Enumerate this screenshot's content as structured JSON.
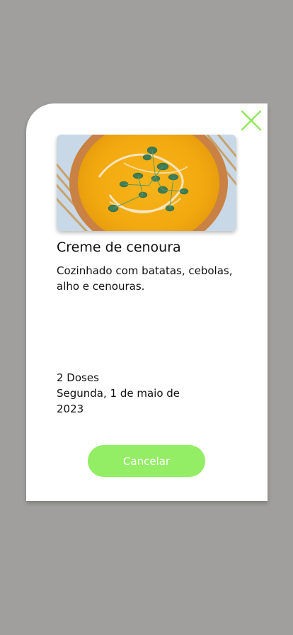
{
  "recipe": {
    "title": "Creme de cenoura",
    "description": "Cozinhado com batatas, cebolas, alho e cenouras.",
    "doses": "2 Doses",
    "date": "Segunda, 1 de maio de 2023"
  },
  "actions": {
    "cancel_label": "Cancelar"
  },
  "icons": {
    "close": "close-icon"
  },
  "colors": {
    "overlay": "#a09f9d",
    "card": "#ffffff",
    "accent": "#94ee65",
    "close_icon": "#8fe85d"
  }
}
